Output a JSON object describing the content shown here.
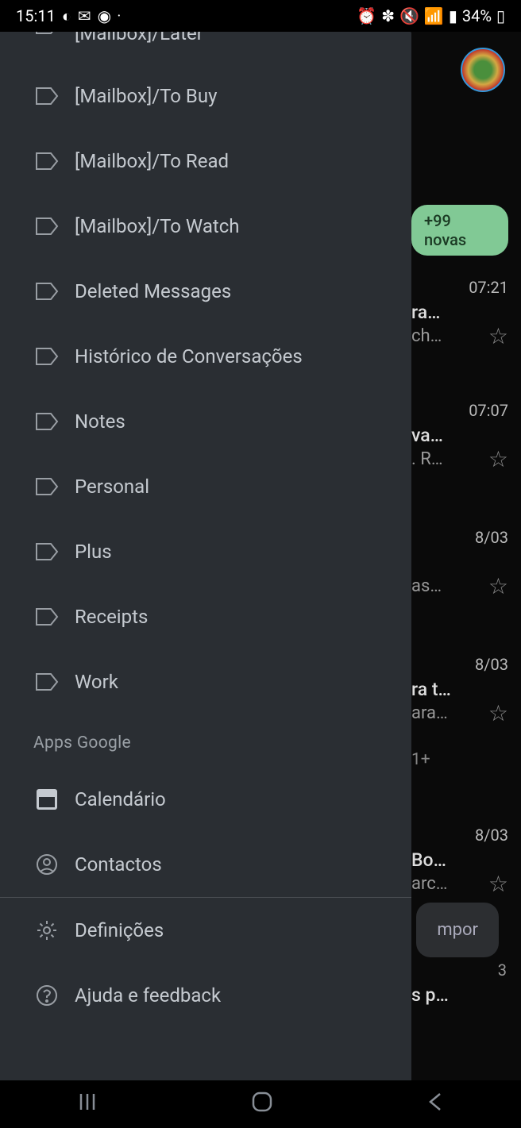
{
  "status": {
    "time": "15:11",
    "battery": "34%"
  },
  "drawer": {
    "labels": [
      "[Mailbox]/Later",
      "[Mailbox]/To Buy",
      "[Mailbox]/To Read",
      "[Mailbox]/To Watch",
      "Deleted Messages",
      "Histórico de Conversações",
      "Notes",
      "Personal",
      "Plus",
      "Receipts",
      "Work"
    ],
    "section_apps": "Apps Google",
    "apps": {
      "calendar": "Calendário",
      "contacts": "Contactos"
    },
    "settings": "Definições",
    "help": "Ajuda e feedback"
  },
  "background": {
    "new_badge": "+99 novas",
    "emails": [
      {
        "time": "07:21",
        "line1": "ra…",
        "line2": "ch…"
      },
      {
        "time": "07:07",
        "line1": "va…",
        "line2": ". R…"
      },
      {
        "time": "8/03",
        "line1": "",
        "line2": "as…"
      },
      {
        "time": "8/03",
        "line1": "ra t…",
        "line2": "ara…"
      },
      {
        "time": "8/03",
        "line1": "Bo…",
        "line2": "arc…"
      }
    ],
    "extra1": "1+",
    "extra2": "s p…",
    "extra3": "3",
    "compose": "mpor"
  }
}
